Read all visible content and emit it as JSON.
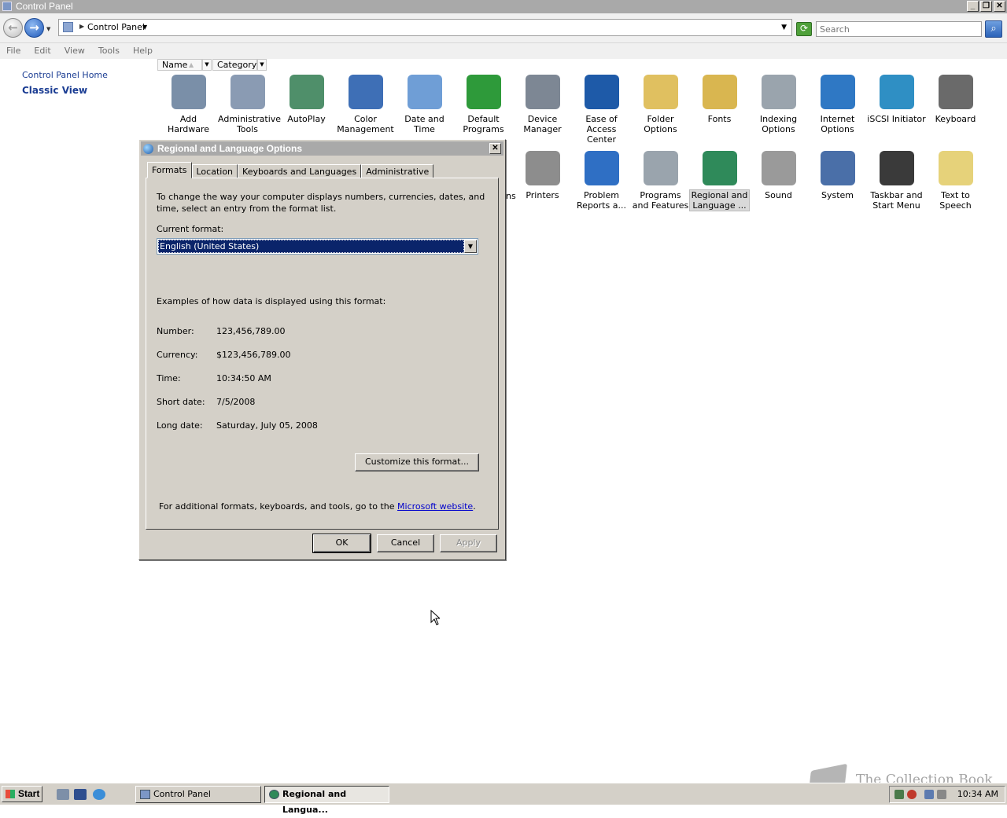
{
  "window": {
    "title": "Control Panel"
  },
  "address": {
    "location": "Control Panel",
    "search_placeholder": "Search"
  },
  "menu": [
    "File",
    "Edit",
    "View",
    "Tools",
    "Help"
  ],
  "left_pane": {
    "home": "Control Panel Home",
    "classic_view": "Classic View"
  },
  "columns": {
    "name": "Name",
    "category": "Category"
  },
  "items_row1": [
    {
      "label": "Add Hardware",
      "icon": "add-hardware-icon",
      "color": "#7a8fa8"
    },
    {
      "label": "Administrative Tools",
      "icon": "administrative-tools-icon",
      "color": "#8a9bb3"
    },
    {
      "label": "AutoPlay",
      "icon": "autoplay-icon",
      "color": "#4f8f6a"
    },
    {
      "label": "Color Management",
      "icon": "color-management-icon",
      "color": "#3e6fb6"
    },
    {
      "label": "Date and Time",
      "icon": "date-time-icon",
      "color": "#6f9ed6"
    },
    {
      "label": "Default Programs",
      "icon": "default-programs-icon",
      "color": "#2e9a3a"
    },
    {
      "label": "Device Manager",
      "icon": "device-manager-icon",
      "color": "#7d8794"
    },
    {
      "label": "Ease of Access Center",
      "icon": "ease-of-access-icon",
      "color": "#1e5aa8"
    },
    {
      "label": "Folder Options",
      "icon": "folder-options-icon",
      "color": "#e0c060"
    },
    {
      "label": "Fonts",
      "icon": "fonts-icon",
      "color": "#d9b650"
    },
    {
      "label": "Indexing Options",
      "icon": "indexing-options-icon",
      "color": "#9aa4ad"
    },
    {
      "label": "Internet Options",
      "icon": "internet-options-icon",
      "color": "#2f78c4"
    },
    {
      "label": "iSCSI Initiator",
      "icon": "iscsi-initiator-icon",
      "color": "#2f8fc4"
    },
    {
      "label": "Keyboard",
      "icon": "keyboard-icon",
      "color": "#6a6a6a"
    }
  ],
  "items_row2": [
    {
      "label": "Printers",
      "icon": "printers-icon",
      "color": "#8d8d8d"
    },
    {
      "label": "Problem Reports a...",
      "icon": "problem-reports-icon",
      "color": "#2f6fc4"
    },
    {
      "label": "Programs and Features",
      "icon": "programs-features-icon",
      "color": "#9aa4ad"
    },
    {
      "label": "Regional and Language ...",
      "icon": "regional-language-icon",
      "color": "#2f8a5a"
    },
    {
      "label": "Sound",
      "icon": "sound-icon",
      "color": "#9a9a9a"
    },
    {
      "label": "System",
      "icon": "system-icon",
      "color": "#4a6fa8"
    },
    {
      "label": "Taskbar and Start Menu",
      "icon": "taskbar-start-menu-icon",
      "color": "#3a3a3a"
    },
    {
      "label": "Text to Speech",
      "icon": "text-to-speech-icon",
      "color": "#e6d27a"
    }
  ],
  "partial_label": "ns",
  "dialog": {
    "title": "Regional and Language Options",
    "tabs": [
      "Formats",
      "Location",
      "Keyboards and Languages",
      "Administrative"
    ],
    "intro_line1": "To change the way your computer displays numbers, currencies, dates, and",
    "intro_line2": "time, select an entry from the format list.",
    "current_format_label": "Current format:",
    "current_format_value": "English (United States)",
    "examples_heading": "Examples of how data is displayed using this format:",
    "examples": [
      {
        "label": "Number:",
        "value": "123,456,789.00"
      },
      {
        "label": "Currency:",
        "value": "$123,456,789.00"
      },
      {
        "label": "Time:",
        "value": "10:34:50 AM"
      },
      {
        "label": "Short date:",
        "value": "7/5/2008"
      },
      {
        "label": "Long date:",
        "value": "Saturday, July 05, 2008"
      }
    ],
    "customize_button": "Customize this format...",
    "footer_text": "For additional formats, keyboards, and tools, go to the",
    "footer_link": "Microsoft website",
    "footer_end": ".",
    "ok": "OK",
    "cancel": "Cancel",
    "apply": "Apply"
  },
  "taskbar": {
    "start": "Start",
    "tasks": [
      "Control Panel",
      "Regional and Langua..."
    ],
    "clock": "10:34 AM"
  },
  "watermark": "The Collection Book"
}
